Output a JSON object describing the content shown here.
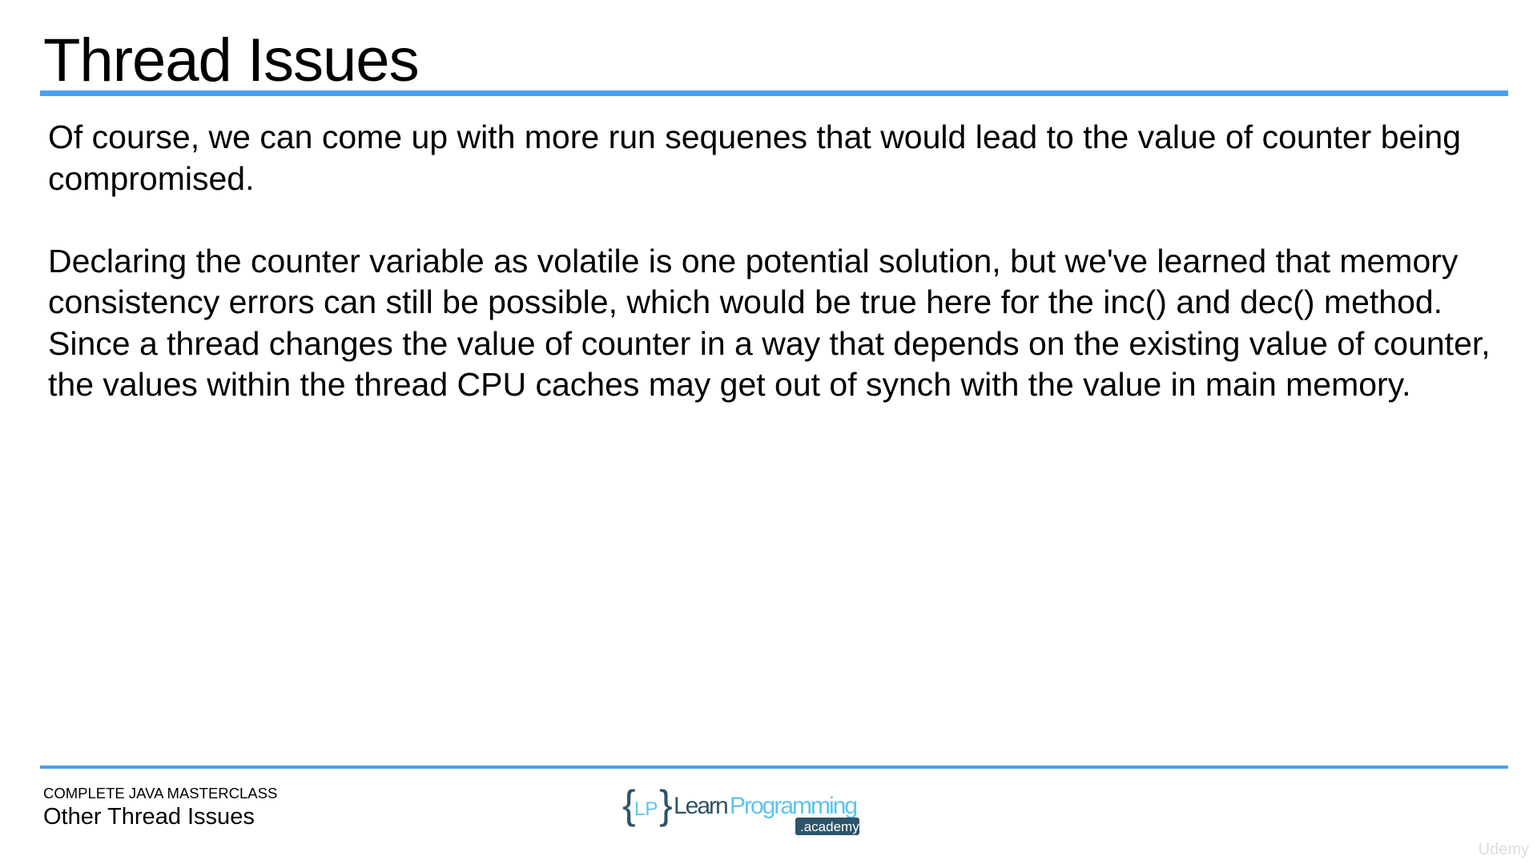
{
  "slide": {
    "title": "Thread Issues",
    "paragraphs": [
      "Of course, we can come up with more run sequenes that would lead to the value of counter being compromised.",
      "Declaring the counter variable as volatile is one potential solution, but we've learned that memory consistency errors can still be possible, which would be true here for the inc() and dec() method. Since a thread changes the value of counter in a way that depends on the existing value of counter, the values within the thread CPU caches may get out of synch with the value in main memory."
    ]
  },
  "footer": {
    "course": "COMPLETE JAVA MASTERCLASS",
    "lecture": "Other Thread Issues",
    "logo": {
      "brace_text": "LP",
      "learn": "Learn",
      "programming": "Programming",
      "academy": ".academy"
    },
    "watermark": "Udemy"
  },
  "colors": {
    "accent": "#4a9ff0",
    "logo_dark": "#2d5468",
    "logo_light": "#5bc4ef"
  }
}
